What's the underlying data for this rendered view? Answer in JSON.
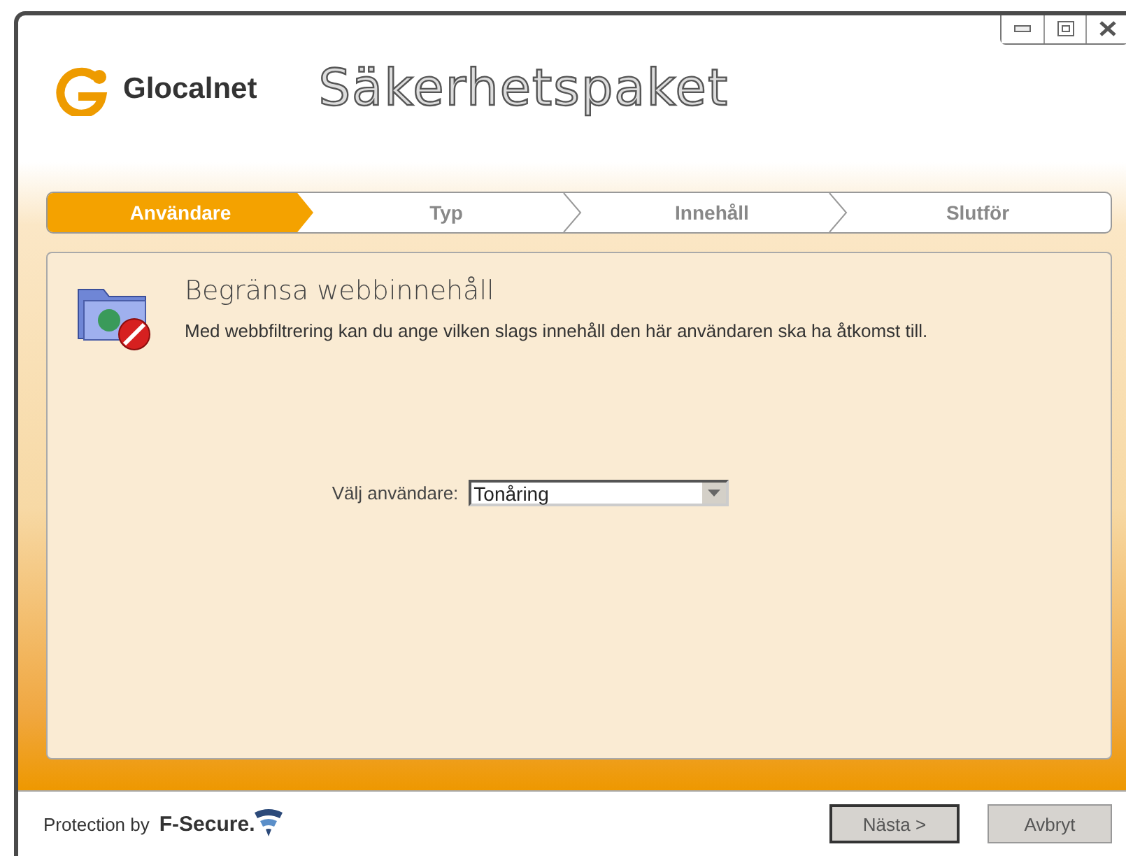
{
  "header": {
    "brand": "Glocalnet",
    "title": "Säkerhetspaket"
  },
  "steps": [
    {
      "label": "Användare",
      "selected": true
    },
    {
      "label": "Typ",
      "selected": false
    },
    {
      "label": "Innehåll",
      "selected": false
    },
    {
      "label": "Slutför",
      "selected": false
    }
  ],
  "panel": {
    "heading": "Begränsa webbinnehåll",
    "description": "Med webbfiltrering kan du ange vilken slags innehåll den här användaren ska ha åtkomst till.",
    "field_label": "Välj användare:",
    "field_value": "Tonåring"
  },
  "footer": {
    "protection_label": "Protection by",
    "vendor": "F-Secure."
  },
  "buttons": [
    {
      "label": "Nästa >",
      "default": true
    },
    {
      "label": "Avbryt",
      "default": false
    }
  ]
}
